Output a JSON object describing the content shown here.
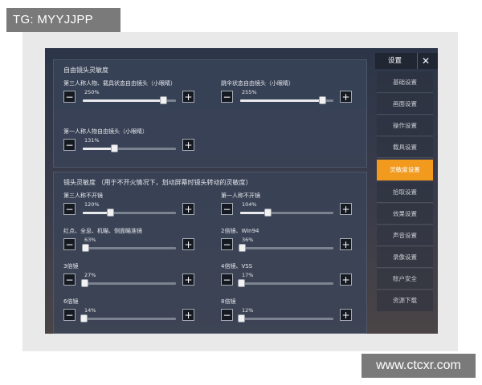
{
  "watermarks": {
    "top": "TG: MYYJJPP",
    "bottom": "www.ctcxr.com"
  },
  "sidebar": {
    "title": "设置",
    "close_label": "✕",
    "items": [
      {
        "label": "基础设置"
      },
      {
        "label": "画面设置"
      },
      {
        "label": "操作设置"
      },
      {
        "label": "载具设置"
      },
      {
        "label": "灵敏度设置",
        "active": true
      },
      {
        "label": "拾取设置"
      },
      {
        "label": "效果设置"
      },
      {
        "label": "声音设置"
      },
      {
        "label": "录像设置"
      },
      {
        "label": "账户安全"
      },
      {
        "label": "资源下载"
      }
    ]
  },
  "sections": [
    {
      "title": "自由镜头灵敏度",
      "settings": [
        {
          "label": "第三人称人物、载具状态自由镜头（小眼睛）",
          "value": "250%",
          "level": 0.86
        },
        {
          "label": "跳伞状态自由镜头（小眼睛）",
          "value": "255%",
          "level": 0.88
        },
        {
          "label": "第一人称人物自由镜头（小眼睛）",
          "value": "131%",
          "level": 0.34
        }
      ]
    },
    {
      "title": "镜头灵敏度 （用于不开火情况下，划动屏幕时镜头转动的灵敏度）",
      "settings": [
        {
          "label": "第三人称不开镜",
          "value": "120%",
          "level": 0.29
        },
        {
          "label": "第一人称不开镜",
          "value": "104%",
          "level": 0.29
        },
        {
          "label": "红点、全息、机瞄、侧面瞄准镜",
          "value": "63%",
          "level": 0.03
        },
        {
          "label": "2倍镜、Win94",
          "value": "36%",
          "level": 0.02
        },
        {
          "label": "3倍镜",
          "value": "27%",
          "level": 0.02
        },
        {
          "label": "4倍镜、VSS",
          "value": "17%",
          "level": 0.01
        },
        {
          "label": "6倍镜",
          "value": "14%",
          "level": 0.01
        },
        {
          "label": "8倍镜",
          "value": "12%",
          "level": 0.01
        }
      ]
    }
  ],
  "controls": {
    "minus": "−",
    "plus": "+"
  },
  "icons": {
    "minus": "minus-icon",
    "plus": "plus-icon",
    "close": "close-icon"
  },
  "colors": {
    "accent": "#f29a1e",
    "panel": "#3a4458",
    "button": "#141922"
  }
}
